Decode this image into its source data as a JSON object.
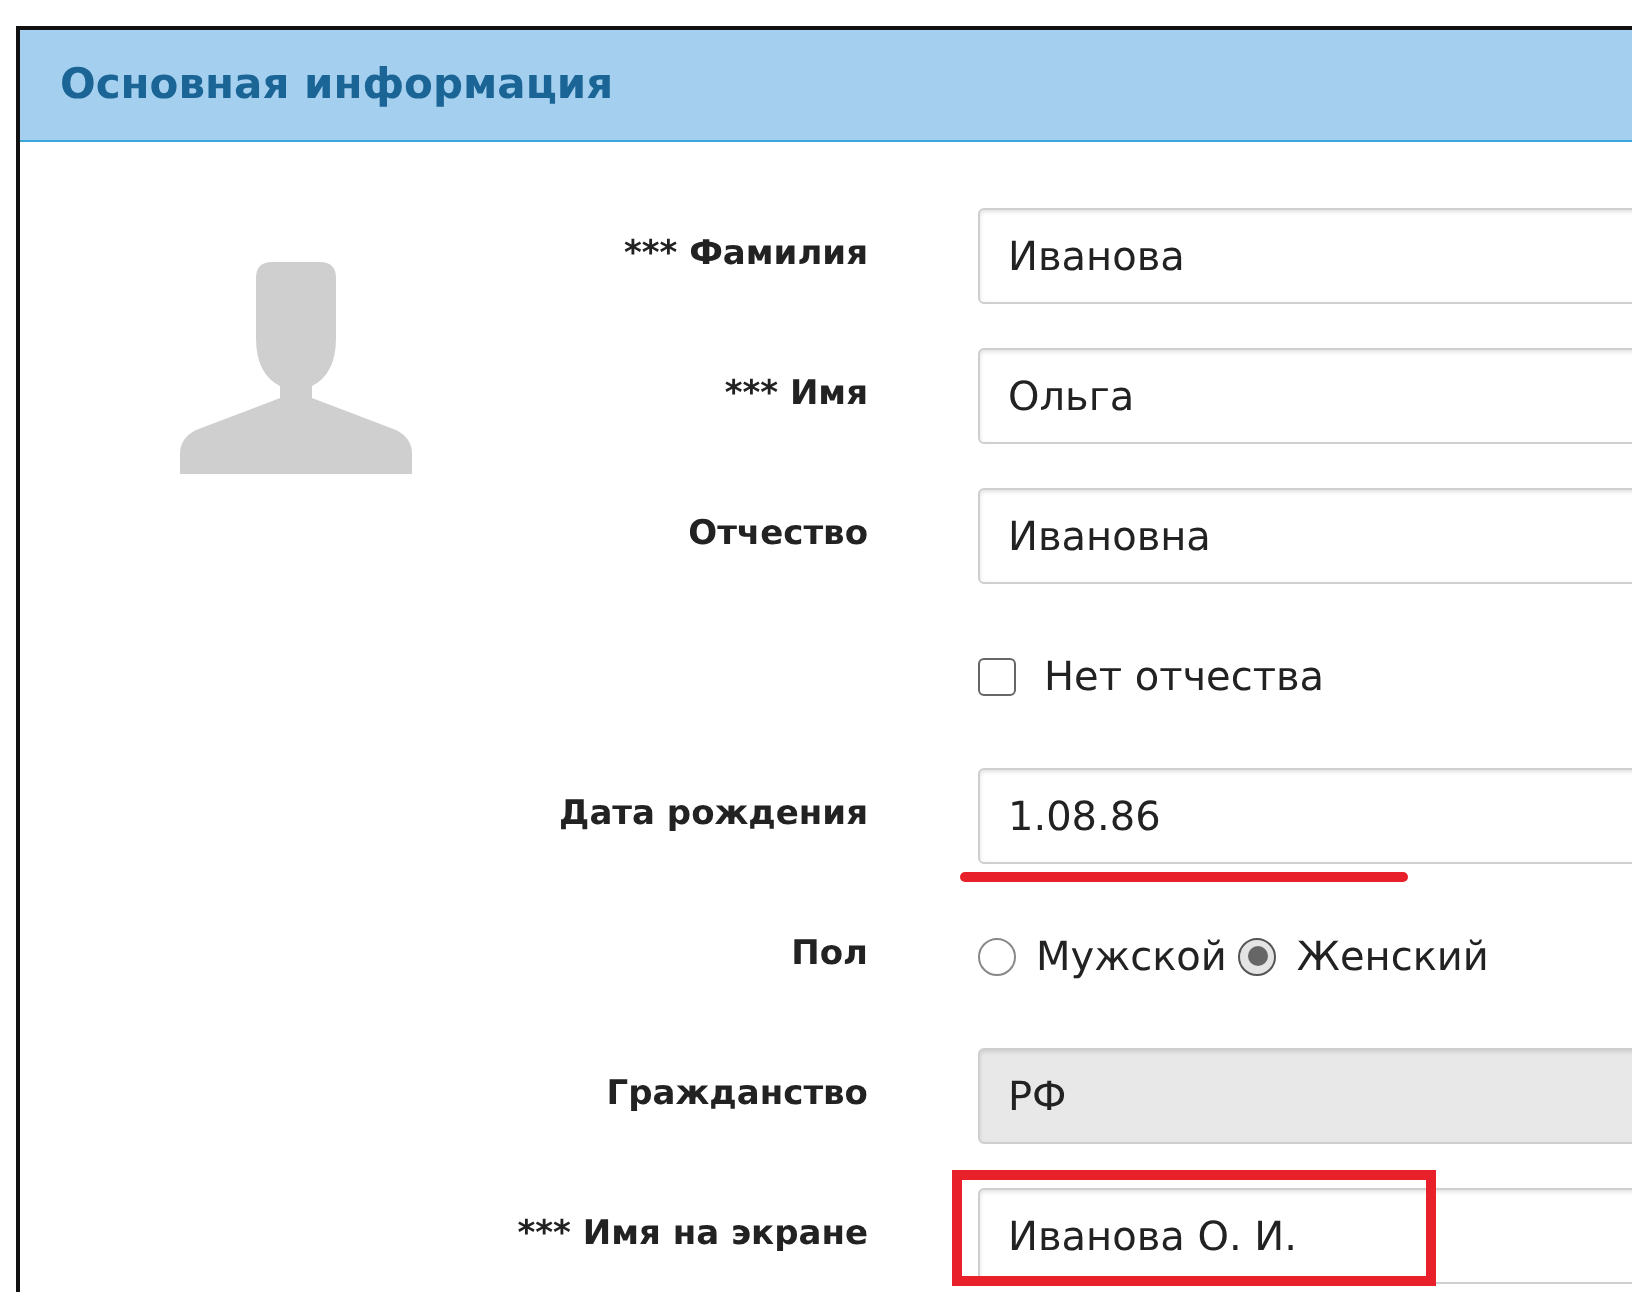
{
  "panel": {
    "title": "Основная информация"
  },
  "fields": [
    {
      "kind": "text",
      "label": "*** Фамилия",
      "value": "Иванова",
      "disabled": false,
      "underlined": false,
      "framed": false
    },
    {
      "kind": "text",
      "label": "*** Имя",
      "value": "Ольга",
      "disabled": false,
      "underlined": false,
      "framed": false
    },
    {
      "kind": "text",
      "label": "Отчество",
      "value": "Ивановна",
      "disabled": false,
      "underlined": false,
      "framed": false
    },
    {
      "kind": "checkbox",
      "label": "Нет отчества",
      "checked": false
    },
    {
      "kind": "text",
      "label": "Дата рождения",
      "value": "1.08.86",
      "disabled": false,
      "underlined": true,
      "framed": false
    },
    {
      "kind": "radio",
      "label": "Пол",
      "options": [
        {
          "label": "Мужской",
          "selected": false
        },
        {
          "label": "Женский",
          "selected": true
        }
      ]
    },
    {
      "kind": "text",
      "label": "Гражданство",
      "value": "РФ",
      "disabled": true,
      "underlined": false,
      "framed": false
    },
    {
      "kind": "text",
      "label": "*** Имя на экране",
      "value": "Иванова О. И.",
      "disabled": false,
      "underlined": false,
      "framed": true
    }
  ]
}
